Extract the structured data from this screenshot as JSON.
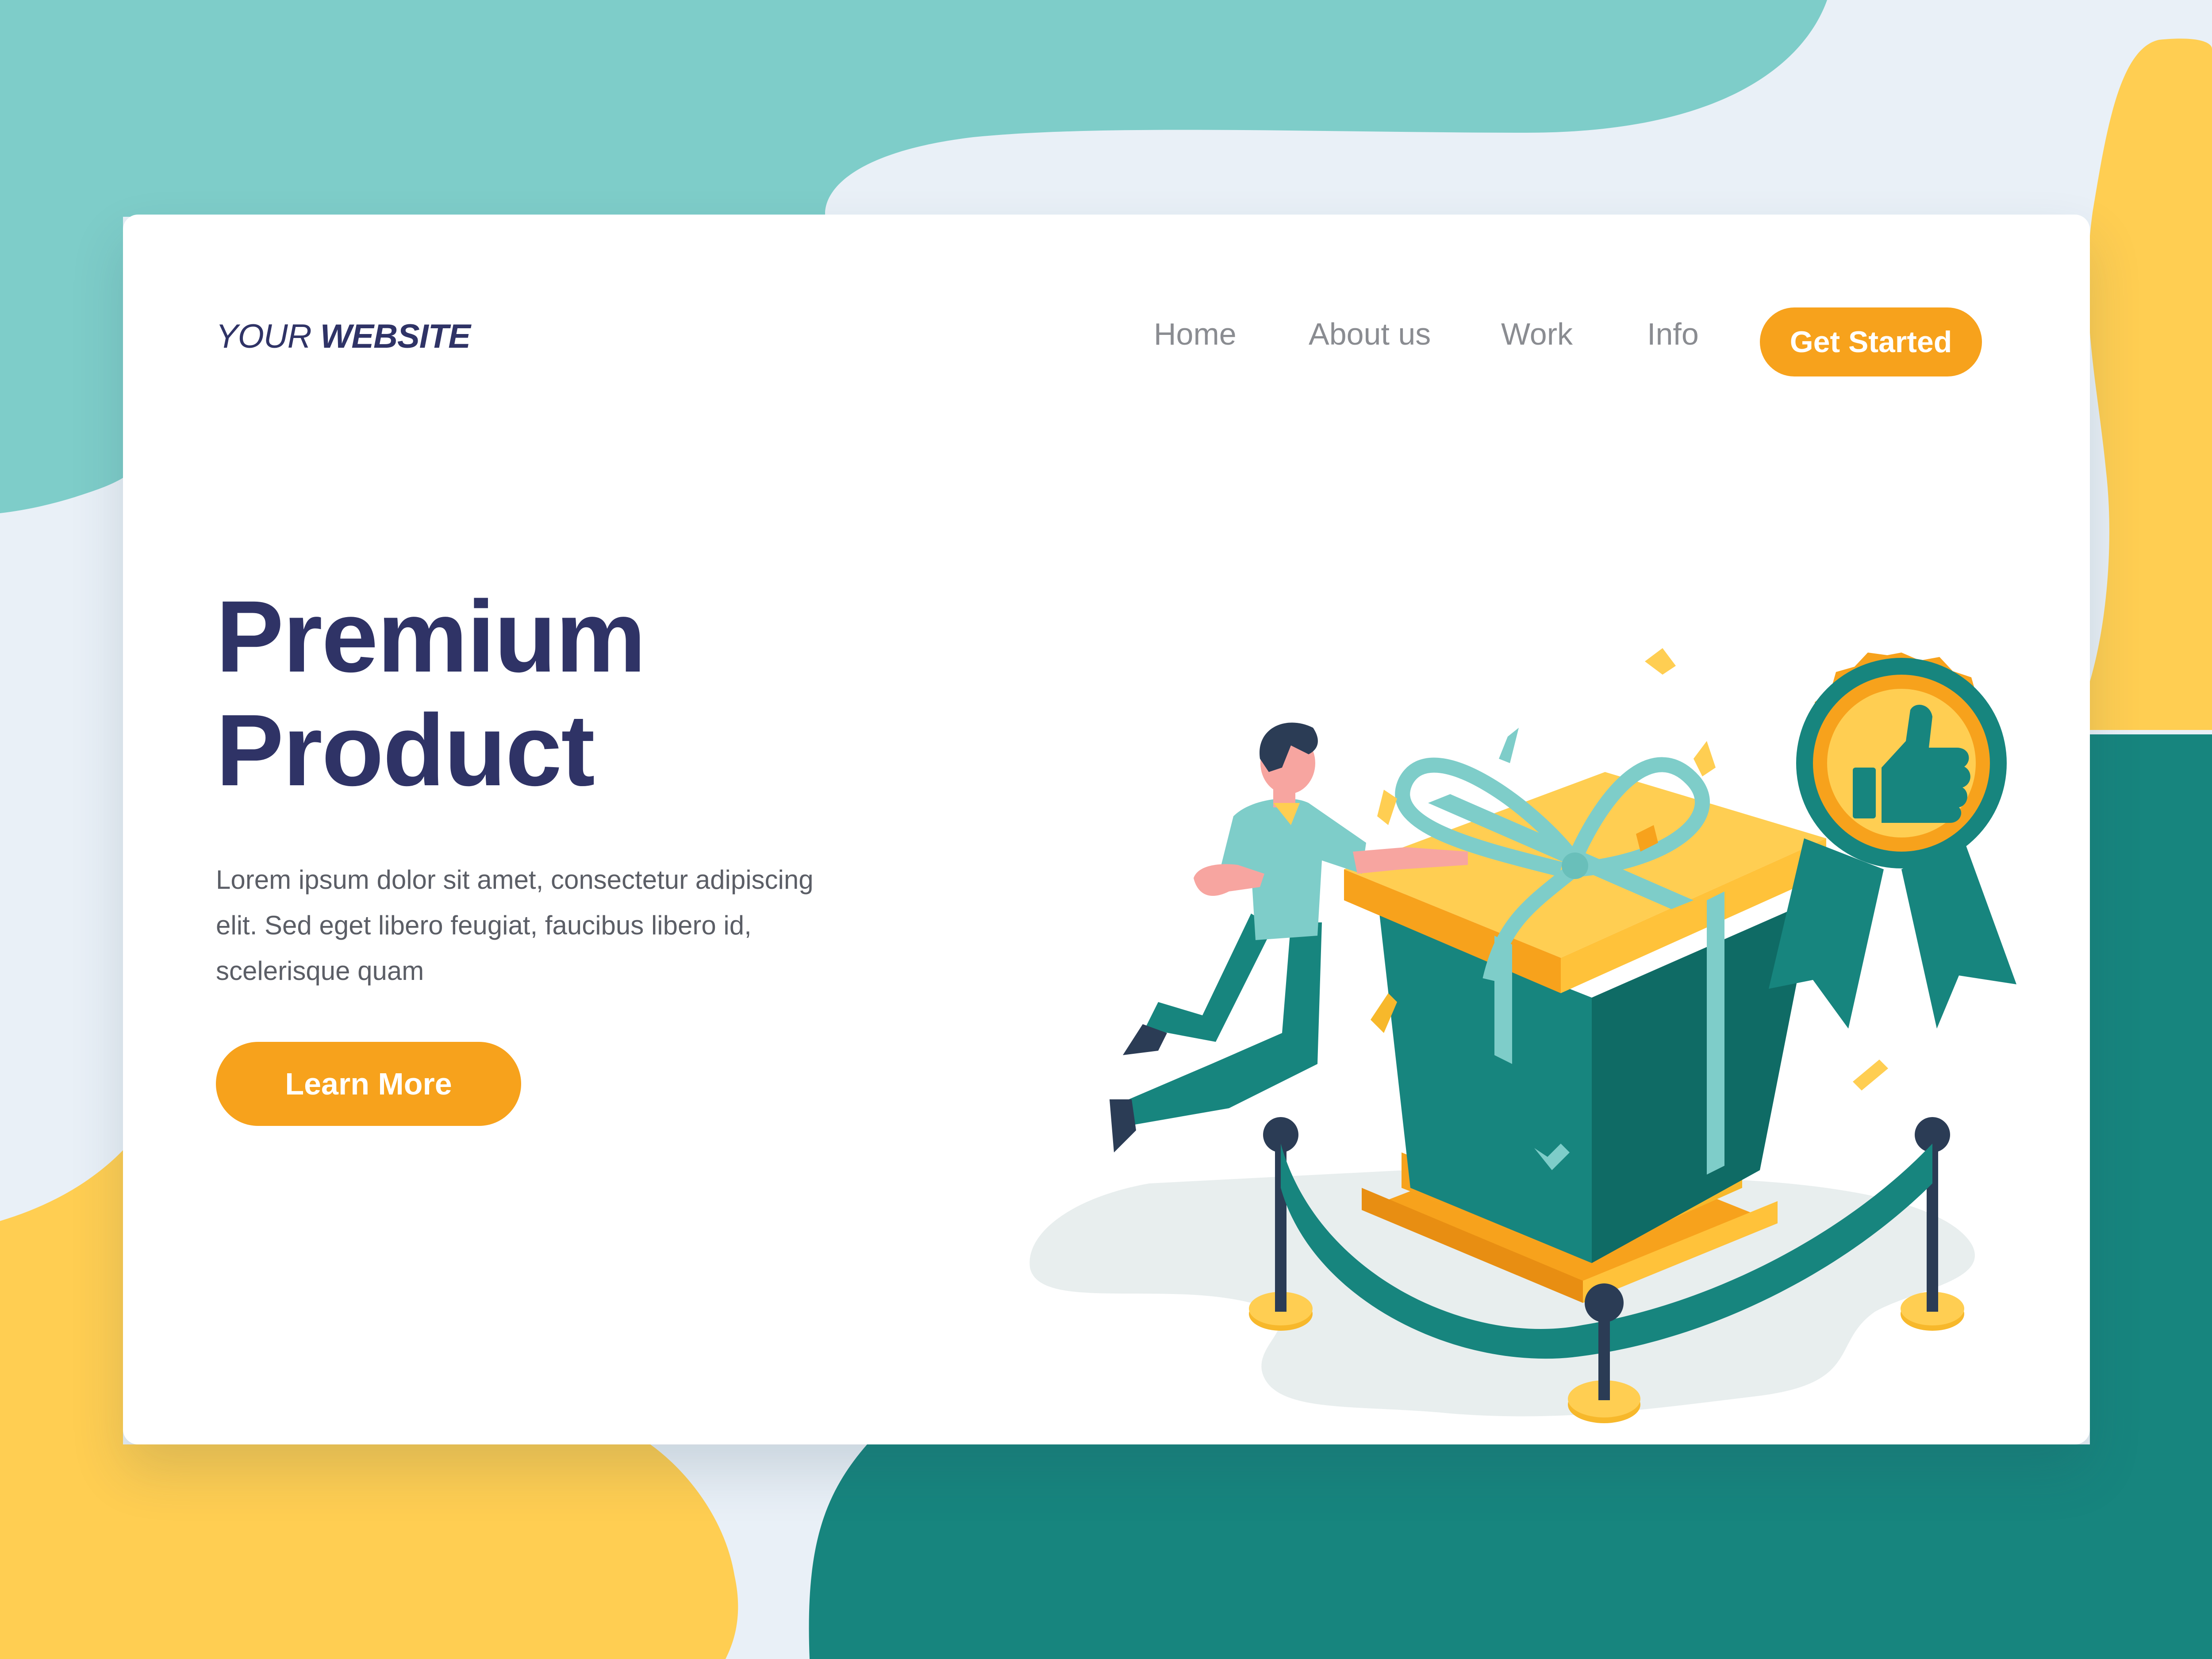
{
  "colors": {
    "accent": "#f7a21c",
    "text_dark": "#2f3366",
    "text_muted": "#8a8c91",
    "teal": "#17857e",
    "teal_light": "#7ecdc9",
    "yellow": "#ffce52",
    "background": "#e9f0f7"
  },
  "brand": {
    "logo_regular": "YOUR",
    "logo_bold": "WEBSITE"
  },
  "nav": {
    "items": [
      {
        "label": "Home"
      },
      {
        "label": "About us"
      },
      {
        "label": "Work"
      },
      {
        "label": "Info"
      }
    ],
    "cta_label": "Get Started"
  },
  "hero": {
    "headline_line1": "Premium",
    "headline_line2": "Product",
    "description": "Lorem ipsum dolor sit amet, consectetur adipiscing elit. Sed eget libero feugiat, faucibus libero id, scelerisque quam",
    "button_label": "Learn More"
  },
  "illustration": {
    "subjects": [
      "person-icon",
      "gift-box-icon",
      "award-badge-icon",
      "thumbs-up-icon",
      "rope-barrier-icon",
      "confetti-icon"
    ]
  }
}
